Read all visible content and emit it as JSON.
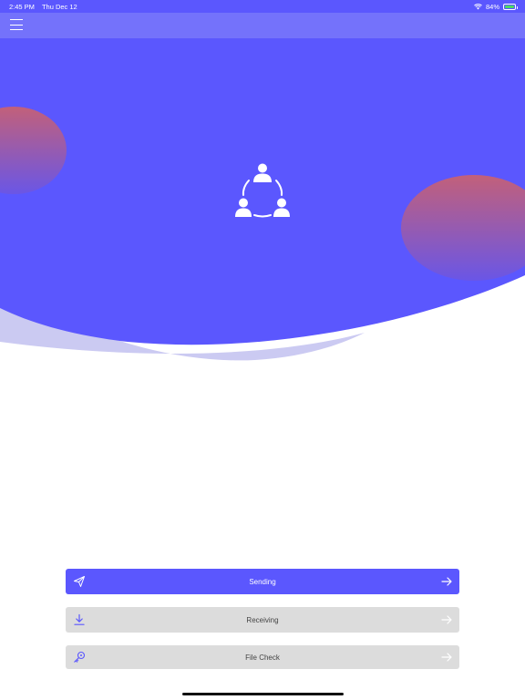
{
  "status_bar": {
    "time": "2:45 PM",
    "date": "Thu Dec 12",
    "battery": "84%",
    "battery_level": 0.84,
    "icons": [
      "wifi-icon",
      "battery-icon"
    ]
  },
  "nav": {
    "menu_icon": "hamburger-menu-icon"
  },
  "hero": {
    "icon": "people-network-icon"
  },
  "actions": [
    {
      "label": "Sending",
      "icon": "paper-plane-icon"
    },
    {
      "label": "Receiving",
      "icon": "download-icon"
    },
    {
      "label": "File Check",
      "icon": "key-icon"
    }
  ],
  "colors": {
    "primary": "#5b57fe",
    "nav_bar": "#7472fb",
    "secondary_button": "#dcdcdc",
    "blob_top": "#c2607a"
  }
}
